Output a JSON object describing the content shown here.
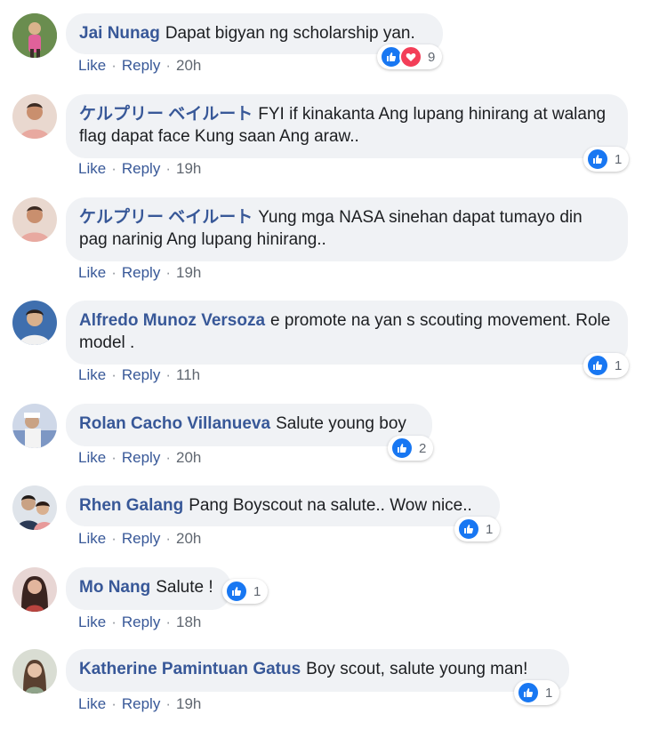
{
  "labels": {
    "like": "Like",
    "reply": "Reply",
    "sep": "·"
  },
  "colors": {
    "link": "#385898",
    "bubble": "#f0f2f5",
    "like": "#1877f2",
    "love": "#f33e58"
  },
  "comments": [
    {
      "author": "Jai Nunag",
      "text": "Dapat bigyan ng scholarship yan.",
      "time": "20h",
      "reaction_count": "9",
      "reactions": [
        "like-icon",
        "heart-icon"
      ]
    },
    {
      "author": "ケルプリー ベイルート",
      "text": "FYI if kinakanta Ang lupang hinirang at walang flag dapat face Kung saan Ang araw..",
      "time": "19h",
      "reaction_count": "1",
      "reactions": [
        "like-icon"
      ]
    },
    {
      "author": "ケルプリー ベイルート",
      "text": "Yung mga NASA sinehan dapat tumayo din pag narinig Ang lupang hinirang..",
      "time": "19h",
      "reaction_count": "",
      "reactions": []
    },
    {
      "author": "Alfredo Munoz Versoza",
      "text": "e promote na yan s scouting movement. Role model .",
      "time": "11h",
      "reaction_count": "1",
      "reactions": [
        "like-icon"
      ]
    },
    {
      "author": "Rolan Cacho Villanueva",
      "text": "Salute young boy",
      "time": "20h",
      "reaction_count": "2",
      "reactions": [
        "like-icon"
      ]
    },
    {
      "author": "Rhen Galang",
      "text": "Pang Boyscout na salute.. Wow nice..",
      "time": "20h",
      "reaction_count": "1",
      "reactions": [
        "like-icon"
      ]
    },
    {
      "author": "Mo Nang",
      "text": "Salute !",
      "time": "18h",
      "reaction_count": "1",
      "reactions": [
        "like-icon"
      ]
    },
    {
      "author": "Katherine Pamintuan Gatus",
      "text": "Boy scout, salute young man!",
      "time": "19h",
      "reaction_count": "1",
      "reactions": [
        "like-icon"
      ]
    }
  ]
}
